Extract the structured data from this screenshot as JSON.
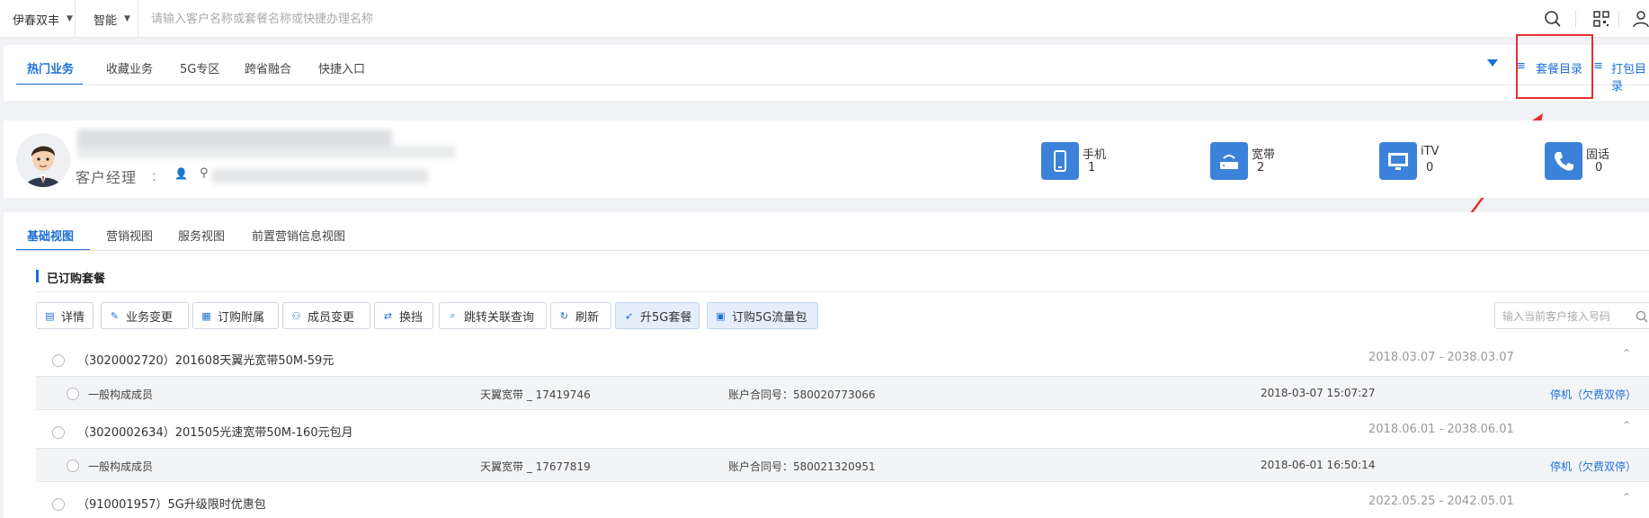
{
  "topbar": {
    "region_select": "伊春双丰",
    "mode_select": "智能",
    "search_placeholder": "请输入客户名称或套餐名称或快捷办理名称"
  },
  "nav": {
    "tabs": [
      "热门业务",
      "收藏业务",
      "5G专区",
      "跨省融合",
      "快捷入口"
    ],
    "active_tab": "热门业务",
    "links": [
      "套餐目录",
      "打包目录"
    ]
  },
  "customer": {
    "manager_label": "客户经理",
    "manager_colon": "：",
    "stats": [
      {
        "label": "手机",
        "count": "1",
        "icon": "mobile-icon"
      },
      {
        "label": "宽带",
        "count": "2",
        "icon": "router-icon"
      },
      {
        "label": "iTV",
        "count": "0",
        "icon": "tv-icon"
      },
      {
        "label": "固话",
        "count": "0",
        "icon": "phone-icon"
      }
    ]
  },
  "main": {
    "view_tabs": [
      "基础视图",
      "营销视图",
      "服务视图",
      "前置营销信息视图"
    ],
    "active_view": "基础视图",
    "section_title": "已订购套餐",
    "actions": [
      {
        "label": "详情",
        "icon": "document-icon",
        "highlight": false
      },
      {
        "label": "业务变更",
        "icon": "edit-icon",
        "highlight": false
      },
      {
        "label": "订购附属",
        "icon": "list-icon",
        "highlight": false
      },
      {
        "label": "成员变更",
        "icon": "user-icon",
        "highlight": false
      },
      {
        "label": "换挡",
        "icon": "swap-icon",
        "highlight": false
      },
      {
        "label": "跳转关联查询",
        "icon": "search-doc-icon",
        "highlight": false
      },
      {
        "label": "刷新",
        "icon": "refresh-icon",
        "highlight": false
      },
      {
        "label": "升5G套餐",
        "icon": "rocket-icon",
        "highlight": true
      },
      {
        "label": "订购5G流量包",
        "icon": "package-icon",
        "highlight": true
      }
    ],
    "line_search_placeholder": "输入当前客户接入号码",
    "packages": [
      {
        "name": "（3020002720）201608天翼光宽带50M-59元",
        "date_range": "2018.03.07 - 2038.03.07",
        "member": {
          "role": "一般构成成员",
          "product": "天翼宽带 _ 17419746",
          "contract": "账户合同号：580020773066",
          "time": "2018-03-07 15:07:27",
          "status": "停机（欠费双停）"
        }
      },
      {
        "name": "（3020002634）201505光速宽带50M-160元包月",
        "date_range": "2018.06.01 - 2038.06.01",
        "member": {
          "role": "一般构成成员",
          "product": "天翼宽带 _ 17677819",
          "contract": "账户合同号：580021320951",
          "time": "2018-06-01 16:50:14",
          "status": "停机（欠费双停）"
        }
      },
      {
        "name": "（910001957）5G升级限时优惠包",
        "date_range": "2022.05.25 - 2042.05.01"
      }
    ]
  },
  "colors": {
    "accent": "#1d6fd6",
    "highlight_box": "#e53030"
  }
}
